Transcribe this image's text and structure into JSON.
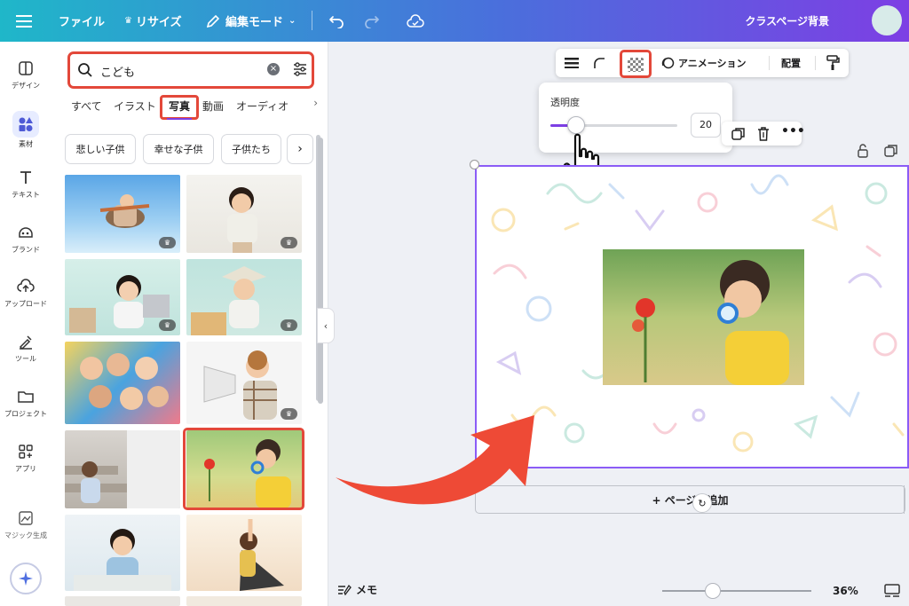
{
  "topbar": {
    "file": "ファイル",
    "resize": "リサイズ",
    "edit_mode": "編集モード",
    "project_title": "クラスページ背景"
  },
  "rail": {
    "items": [
      {
        "label": "デザイン",
        "icon": "design-icon"
      },
      {
        "label": "素材",
        "icon": "elements-icon"
      },
      {
        "label": "テキスト",
        "icon": "text-icon"
      },
      {
        "label": "ブランド",
        "icon": "brand-icon"
      },
      {
        "label": "アップロード",
        "icon": "upload-icon"
      },
      {
        "label": "ツール",
        "icon": "tools-icon"
      },
      {
        "label": "プロジェクト",
        "icon": "folder-icon"
      },
      {
        "label": "アプリ",
        "icon": "apps-icon"
      },
      {
        "label": "マジック生成",
        "icon": "magic-media-icon"
      }
    ]
  },
  "panel": {
    "search_value": "こども",
    "tabs": [
      "すべて",
      "イラスト",
      "写真",
      "動画",
      "オーディオ"
    ],
    "active_tab": "写真",
    "chips": [
      "悲しい子供",
      "幸せな子供",
      "子供たち"
    ]
  },
  "toolbar": {
    "animation": "アニメーション",
    "position": "配置"
  },
  "transparency": {
    "title": "透明度",
    "value": "20",
    "level": 0.2
  },
  "canvas": {
    "add_page": "+ ページを追加"
  },
  "bottom": {
    "memo": "メモ",
    "zoom": "36%"
  },
  "colors": {
    "highlight": "#e3483a",
    "accent": "#7d3fe4",
    "arrow": "#ee4a36"
  }
}
